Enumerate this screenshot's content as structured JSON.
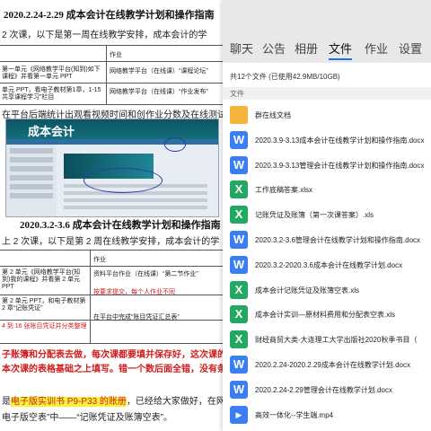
{
  "doc": {
    "title1": "2020.2.24-2.29 成本会计在线教学计划和操作指南",
    "line1": "2 次课，以下是第一周在线教学安排，成本会计的学",
    "table1_head": "作业",
    "table1_r1a": "第一单元《网络教学平台(知到)如下课程》并看第一单元 PPT",
    "table1_r1b": "网络教学平台（在线课）“课程论坛”",
    "table1_r2a": "单元 PPT，看电子教材第1章，1-15 共享课程学习”栏目",
    "table1_r2b": "网络教学平台（在线课）“作业发布”",
    "line2": "在平台后端统计出观看视频时间和创作业分数及在线测试",
    "screen_title": "成本会计",
    "title2": "2020.3.2-3.6 成本会计在线教学计划和操作指南",
    "line3": "上 2 次课，以下是第 2 周在线教学安排，成本会计的学",
    "table2_head": "作业",
    "table2_r1a": "第 2 单元《网络教学平台(知到)我的课程》并看第 2 单元 PPT",
    "table2_r1b": "资料平台作业（在线课）“第二节作业”",
    "table2_r2a": "第 2 单元 PPT，和电子教材第 2 章“记账凭证”",
    "table2_r2b": "按要求提交，每个人作业不同",
    "table2_r3a": "4 到 16 张账目凭证并分类整理",
    "table2_r3b": "在平台中完成“账目凭证汇总表”",
    "line4": "子账簿和分配表去做，每次课都要填并保存好，这次课的 1",
    "line5": "本次课的表格基础之上填写。错一个数后面全错，没有条件",
    "line6a": "是",
    "line6b": "电子版实训书 P9-P33 的账册",
    "line6c": "，已经给大家做好，在网络",
    "line7": "电子版空表”中——“记账凭证及账簿空表”。"
  },
  "panel": {
    "tabs": [
      "聊天",
      "公告",
      "相册",
      "文件",
      "作业",
      "设置"
    ],
    "active_tab": "文件",
    "summary": "共12个文件 (已使用42.9MB/10GB)",
    "section_label": "文件",
    "files": [
      {
        "name": "群在线文档",
        "type": "folder",
        "icon": "folder-icon"
      },
      {
        "name": "2020.3.9-3.13成本会计在线教学计划和操作指南.docx",
        "type": "word",
        "icon": "word-icon"
      },
      {
        "name": "2020.3.9-3.13管理会计在线教学计划和操作指南.docx",
        "type": "word",
        "icon": "word-icon"
      },
      {
        "name": "工作底稿答案.xlsx",
        "type": "excel",
        "icon": "excel-icon"
      },
      {
        "name": "记账凭证及账簿（第一次课答案）.xls",
        "type": "excel",
        "icon": "excel-icon"
      },
      {
        "name": "2020.3.2-3.6管理会计在线教学计划和操作指南.docx",
        "type": "word",
        "icon": "word-icon"
      },
      {
        "name": "2020.3.2-2020.3.6成本会计在线教学计划.docx",
        "type": "word",
        "icon": "word-icon"
      },
      {
        "name": "成本会计记账凭证及账簿空表.xls",
        "type": "excel",
        "icon": "excel-icon"
      },
      {
        "name": "成本会计实训—原材料费用和分配表空表.xls",
        "type": "excel",
        "icon": "excel-icon"
      },
      {
        "name": "财经商贸大类-大连理工大学出版社2020秋季书目（",
        "type": "excel",
        "icon": "excel-icon"
      },
      {
        "name": "2020.2.24-2020.2.29成本会计在线教学计划.docx",
        "type": "word",
        "icon": "word-icon"
      },
      {
        "name": "2020.2.24-2.29管理会计在线教学计划.docx",
        "type": "word",
        "icon": "word-icon"
      },
      {
        "name": "高效一体化--学生端.mp4",
        "type": "video",
        "icon": "video-icon"
      }
    ]
  }
}
